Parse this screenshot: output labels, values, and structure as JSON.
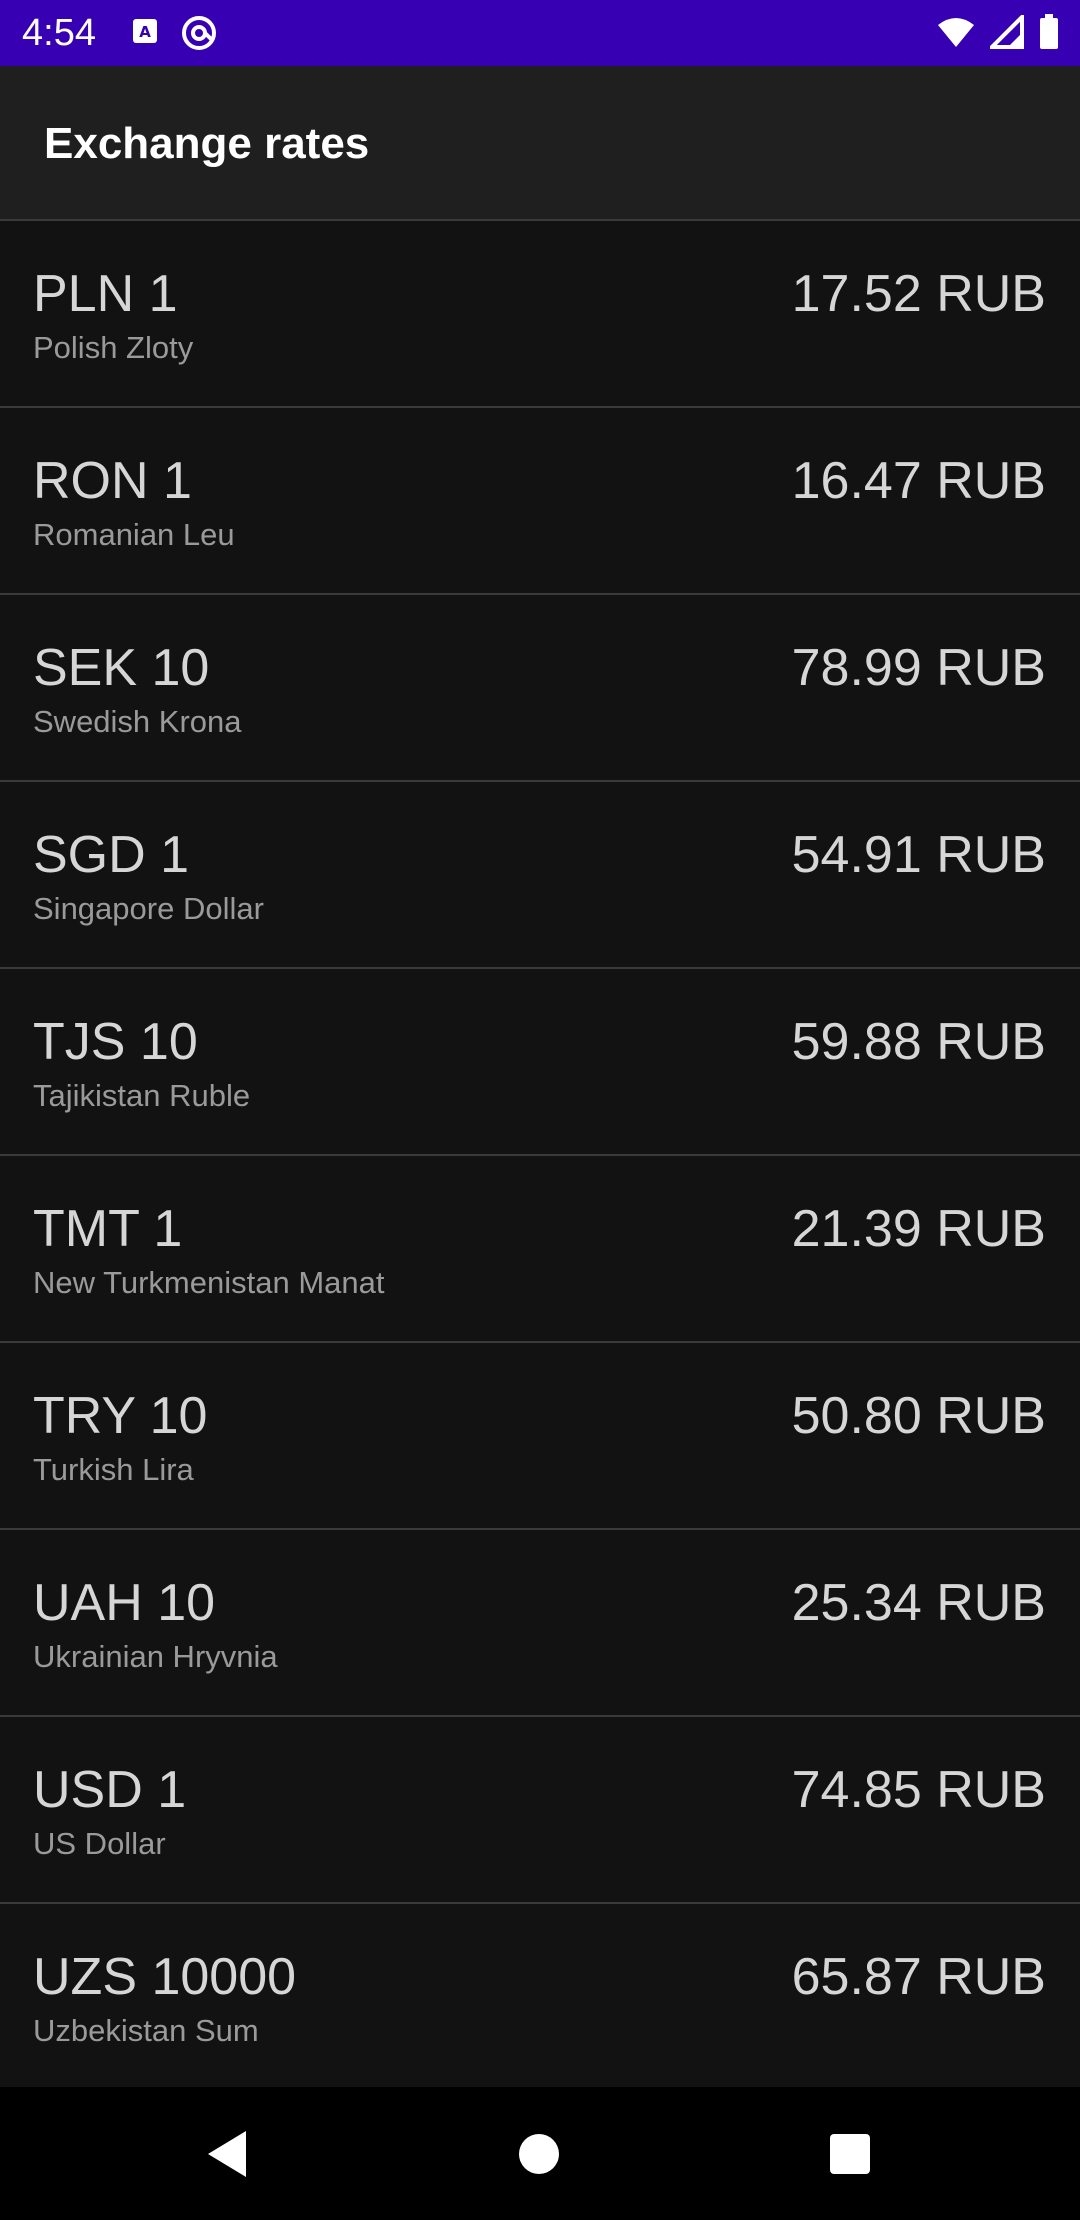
{
  "status_bar": {
    "time": "4:54",
    "left_icons": [
      "text-accessibility-icon",
      "at-sign-icon"
    ],
    "right_icons": [
      "wifi-icon",
      "cellular-signal-icon",
      "battery-icon"
    ],
    "background": "#3700B3"
  },
  "app_bar": {
    "title": "Exchange rates"
  },
  "rates": [
    {
      "code": "PLN 1",
      "name": "Polish Zloty",
      "rate": "17.52 RUB"
    },
    {
      "code": "RON 1",
      "name": "Romanian Leu",
      "rate": "16.47 RUB"
    },
    {
      "code": "SEK 10",
      "name": "Swedish Krona",
      "rate": "78.99 RUB"
    },
    {
      "code": "SGD 1",
      "name": "Singapore Dollar",
      "rate": "54.91 RUB"
    },
    {
      "code": "TJS 10",
      "name": "Tajikistan Ruble",
      "rate": "59.88 RUB"
    },
    {
      "code": "TMT 1",
      "name": "New Turkmenistan Manat",
      "rate": "21.39 RUB"
    },
    {
      "code": "TRY 10",
      "name": "Turkish Lira",
      "rate": "50.80 RUB"
    },
    {
      "code": "UAH 10",
      "name": "Ukrainian Hryvnia",
      "rate": "25.34 RUB"
    },
    {
      "code": "USD 1",
      "name": "US Dollar",
      "rate": "74.85 RUB"
    },
    {
      "code": "UZS 10000",
      "name": "Uzbekistan Sum",
      "rate": "65.87 RUB"
    }
  ],
  "nav_bar": {
    "buttons": [
      "back-icon",
      "home-icon",
      "recents-icon"
    ]
  }
}
